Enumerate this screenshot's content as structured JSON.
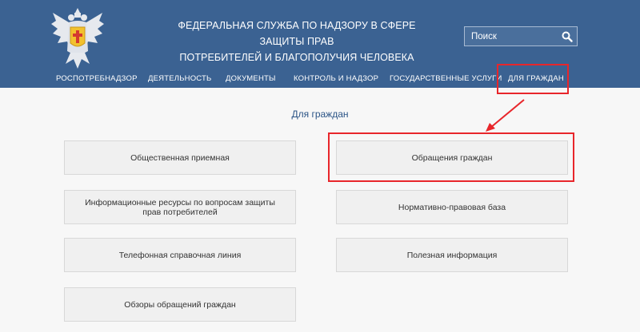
{
  "header": {
    "title_line1": "ФЕДЕРАЛЬНАЯ СЛУЖБА ПО НАДЗОРУ В СФЕРЕ ЗАЩИТЫ ПРАВ",
    "title_line2": "ПОТРЕБИТЕЛЕЙ И БЛАГОПОЛУЧИЯ ЧЕЛОВЕКА",
    "logo_icon": "double-headed-eagle-emblem"
  },
  "search": {
    "placeholder": "Поиск",
    "icon": "search-icon"
  },
  "nav": {
    "items": [
      "РОСПОТРЕБНАДЗОР",
      "ДЕЯТЕЛЬНОСТЬ",
      "ДОКУМЕНТЫ",
      "КОНТРОЛЬ И НАДЗОР",
      "ГОСУДАРСТВЕННЫЕ УСЛУГИ",
      "ДЛЯ ГРАЖДАН"
    ]
  },
  "main": {
    "title": "Для граждан",
    "cards": [
      "Общественная приемная",
      "Обращения граждан",
      "Информационные ресурсы по вопросам защиты прав потребителей",
      "Нормативно-правовая база",
      "Телефонная справочная линия",
      "Полезная информация",
      "Обзоры обращений граждан"
    ]
  },
  "colors": {
    "header_bg": "#3b6292",
    "annotation_red": "#e8262b",
    "title_blue": "#2b5486",
    "card_bg": "#f0f0f0"
  }
}
